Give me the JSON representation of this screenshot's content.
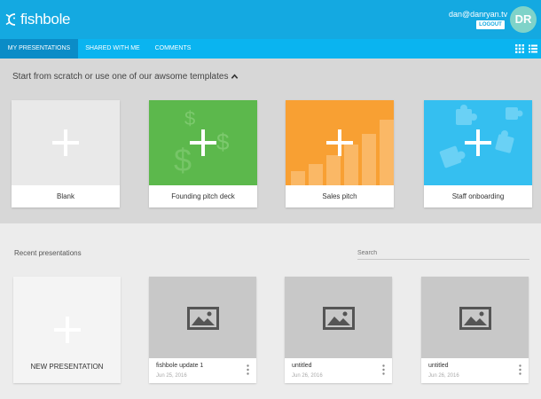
{
  "app": {
    "name": "fishbole"
  },
  "user": {
    "email": "dan@danryan.tv",
    "logout_label": "LOGOUT",
    "initials": "DR",
    "avatar_color": "#7fd3c9"
  },
  "colors": {
    "header": "#14a9e1",
    "tabbar": "#0ab4f0",
    "tab_active": "#0b8cc7",
    "green": "#5cb84c",
    "orange": "#f8a033",
    "blue": "#35bff0"
  },
  "tabs": [
    {
      "label": "MY PRESENTATIONS",
      "active": true
    },
    {
      "label": "SHARED WITH ME",
      "active": false
    },
    {
      "label": "COMMENTS",
      "active": false
    }
  ],
  "view_icons": [
    "grid-view-icon",
    "list-view-icon"
  ],
  "templates": {
    "title": "Start from scratch or use one of our awsome templates",
    "items": [
      {
        "label": "Blank",
        "art": "plus-icon"
      },
      {
        "label": "Founding pitch deck",
        "art": "dollar-signs"
      },
      {
        "label": "Sales pitch",
        "art": "bar-graph"
      },
      {
        "label": "Staff onboarding",
        "art": "puzzle-pieces"
      }
    ]
  },
  "recent": {
    "title": "Recent presentations",
    "search_placeholder": "Search",
    "new_label": "NEW PRESENTATION",
    "items": [
      {
        "name": "fishbole update 1",
        "date": "Jun 25, 2016"
      },
      {
        "name": "untitled",
        "date": "Jun 26, 2016"
      },
      {
        "name": "untitled",
        "date": "Jun 26, 2016"
      }
    ]
  }
}
